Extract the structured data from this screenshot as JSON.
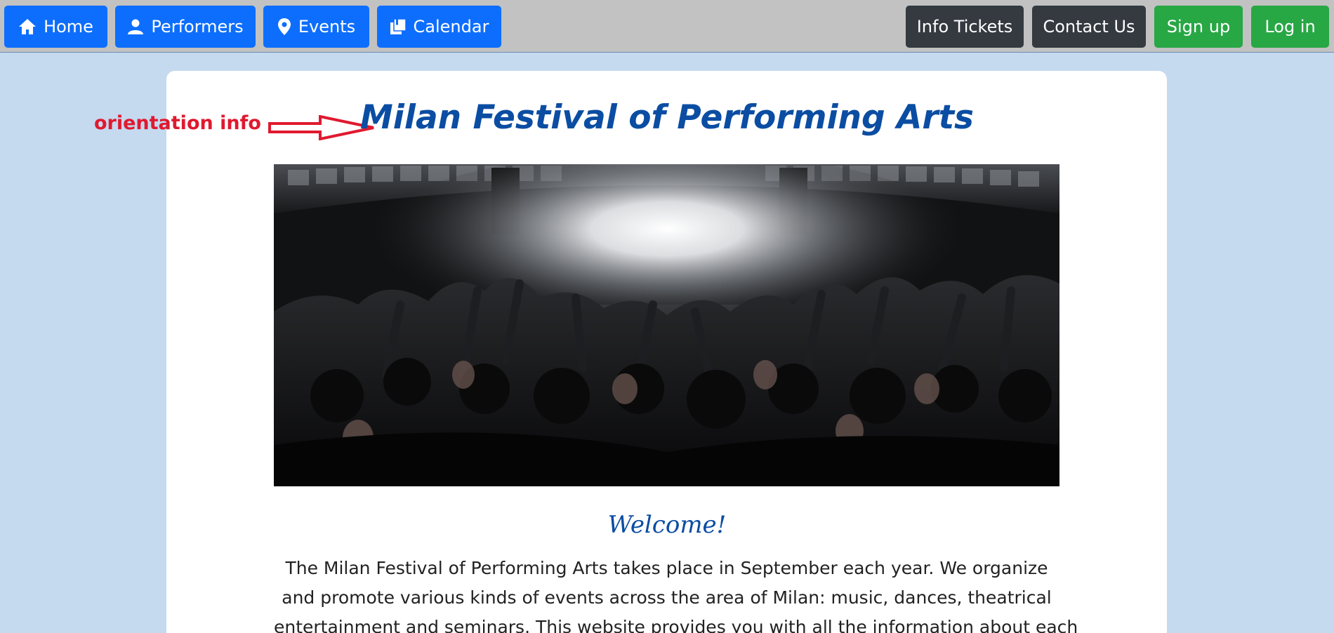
{
  "nav": {
    "left": [
      {
        "label": "Home",
        "icon": "home-icon"
      },
      {
        "label": "Performers",
        "icon": "person-icon"
      },
      {
        "label": "Events",
        "icon": "map-pin-icon"
      },
      {
        "label": "Calendar",
        "icon": "calendar-icon"
      }
    ],
    "right": [
      {
        "label": "Info Tickets"
      },
      {
        "label": "Contact Us"
      },
      {
        "label": "Sign up"
      },
      {
        "label": "Log in"
      }
    ]
  },
  "annotation": {
    "label": "orientation info",
    "color": "#e0192f"
  },
  "main": {
    "title": "Milan Festival of Performing Arts",
    "welcome": "Welcome!",
    "intro_lines": [
      "The Milan Festival of Performing Arts takes place in September each year. We organize",
      "and promote various kinds of events across the area of Milan: music, dances, theatrical",
      "entertainment and seminars. This website provides you with all the information about each"
    ]
  },
  "colors": {
    "navbar_bg": "#c2c2c2",
    "page_bg": "#c5d9ef",
    "primary_blue": "#0d6efd",
    "dark": "#343a40",
    "success_green": "#28a745",
    "title_blue": "#0b4da2"
  }
}
